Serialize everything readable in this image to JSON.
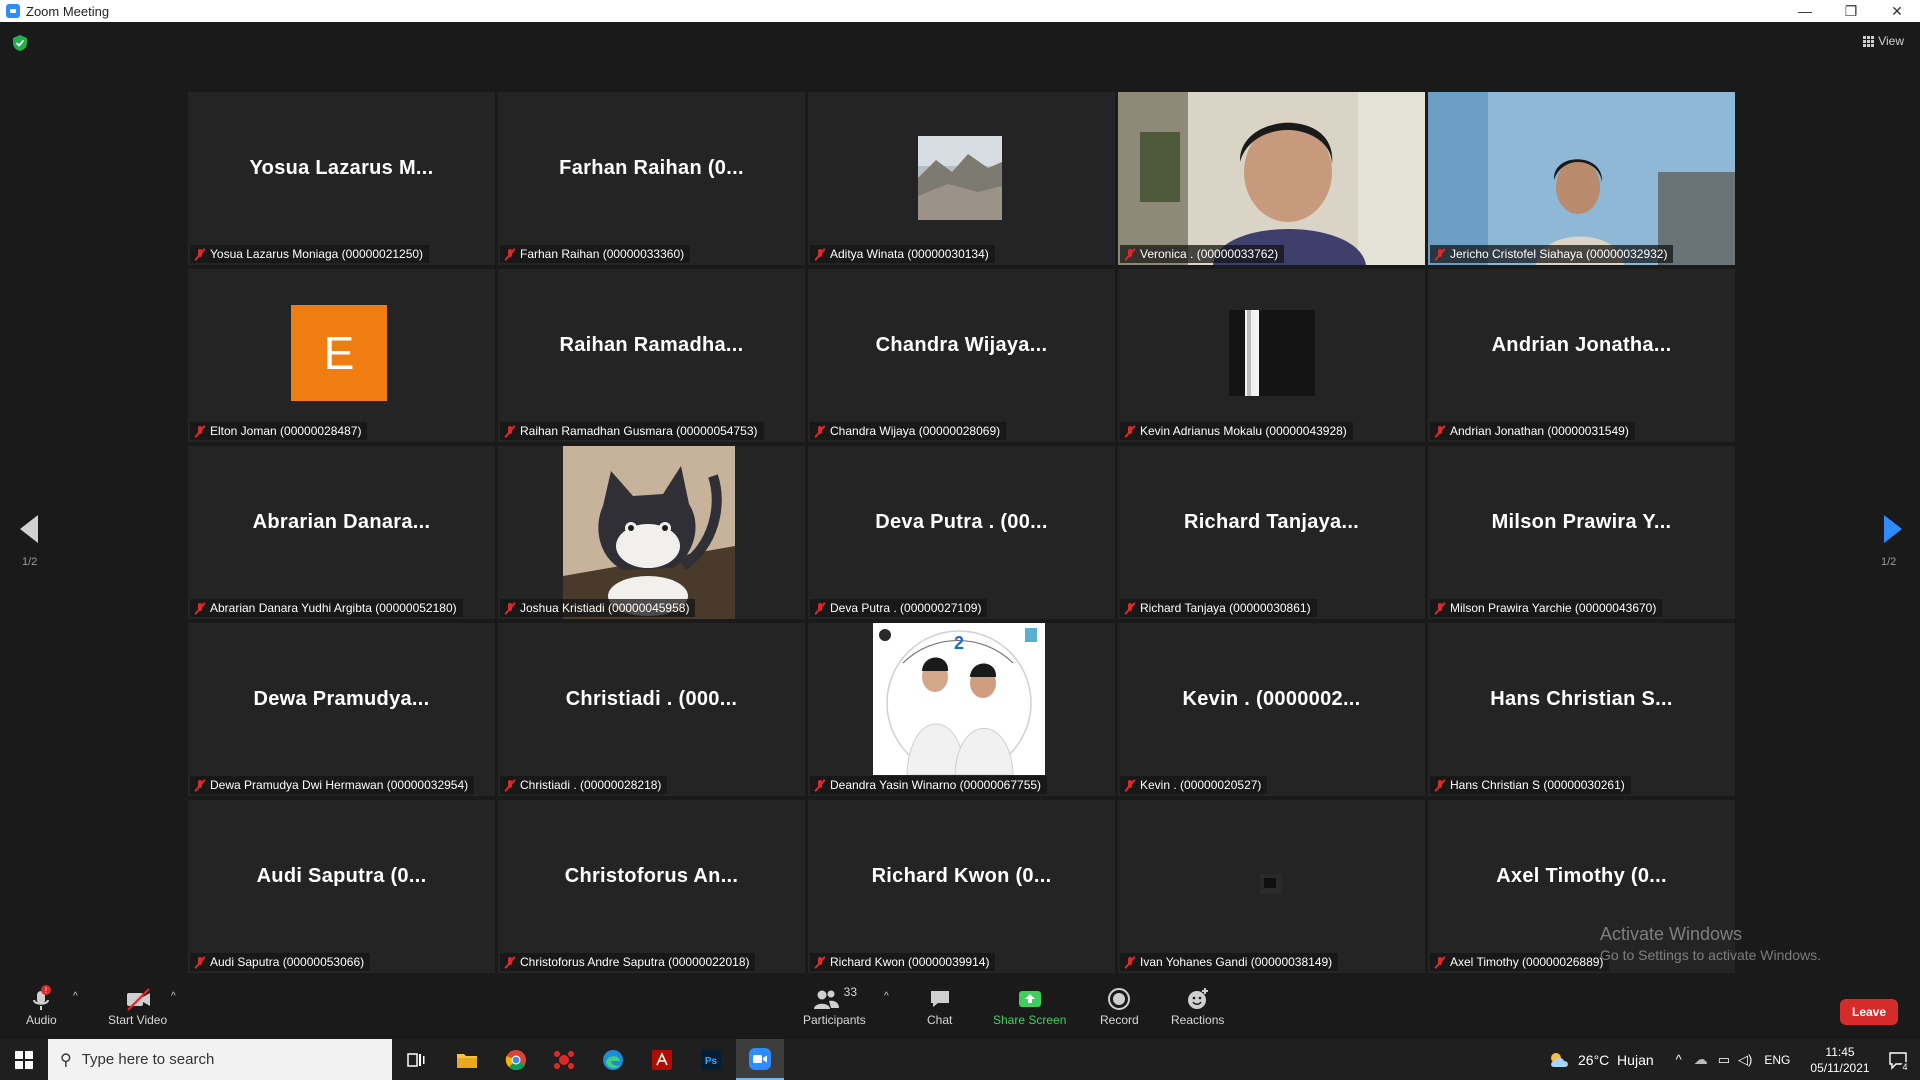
{
  "window": {
    "title": "Zoom Meeting",
    "controls": [
      "—",
      "❐",
      "✕"
    ]
  },
  "meeting": {
    "view_label": "View",
    "page_left": "1/2",
    "page_right": "1/2",
    "active_speaker_color": "#c8e650",
    "tiles": [
      {
        "display": "Yosua Lazarus M...",
        "label": "Yosua Lazarus Moniaga (00000021250)",
        "kind": "name"
      },
      {
        "display": "Farhan Raihan (0...",
        "label": "Farhan Raihan (00000033360)",
        "kind": "name"
      },
      {
        "display": "",
        "label": "Aditya Winata (00000030134)",
        "kind": "mountain"
      },
      {
        "display": "",
        "label": "Veronica . (00000033762)",
        "kind": "video-girl",
        "active": true
      },
      {
        "display": "",
        "label": "Jericho Cristofel Siahaya (00000032932)",
        "kind": "video-boy"
      },
      {
        "display": "E",
        "label": "Elton Joman (00000028487)",
        "kind": "avatar-letter"
      },
      {
        "display": "Raihan Ramadha...",
        "label": "Raihan Ramadhan Gusmara (00000054753)",
        "kind": "name"
      },
      {
        "display": "Chandra Wijaya...",
        "label": "Chandra Wijaya (00000028069)",
        "kind": "name"
      },
      {
        "display": "",
        "label": "Kevin Adrianus Mokalu (00000043928)",
        "kind": "dark-pic"
      },
      {
        "display": "Andrian Jonatha...",
        "label": "Andrian Jonathan (00000031549)",
        "kind": "name"
      },
      {
        "display": "Abrarian Danara...",
        "label": "Abrarian Danara Yudhi Argibta (00000052180)",
        "kind": "name"
      },
      {
        "display": "",
        "label": "Joshua Kristiadi (00000045958)",
        "kind": "cat"
      },
      {
        "display": "Deva Putra . (00...",
        "label": "Deva Putra . (00000027109)",
        "kind": "name"
      },
      {
        "display": "Richard Tanjaya...",
        "label": "Richard Tanjaya (00000030861)",
        "kind": "name"
      },
      {
        "display": "Milson Prawira Y...",
        "label": "Milson Prawira Yarchie (00000043670)",
        "kind": "name"
      },
      {
        "display": "Dewa Pramudya...",
        "label": "Dewa Pramudya Dwi Hermawan (00000032954)",
        "kind": "name"
      },
      {
        "display": "Christiadi . (000...",
        "label": "Christiadi . (00000028218)",
        "kind": "name"
      },
      {
        "display": "",
        "label": "Deandra Yasin Winarno (00000067755)",
        "kind": "photo"
      },
      {
        "display": "Kevin . (0000002...",
        "label": "Kevin . (00000020527)",
        "kind": "name"
      },
      {
        "display": "Hans Christian S...",
        "label": "Hans Christian S (00000030261)",
        "kind": "name"
      },
      {
        "display": "Audi Saputra (0...",
        "label": "Audi Saputra (00000053066)",
        "kind": "name"
      },
      {
        "display": "Christoforus An...",
        "label": "Christoforus Andre Saputra (00000022018)",
        "kind": "name"
      },
      {
        "display": "Richard Kwon (0...",
        "label": "Richard Kwon (00000039914)",
        "kind": "name"
      },
      {
        "display": "",
        "label": "Ivan Yohanes Gandi (00000038149)",
        "kind": "tiny-pic"
      },
      {
        "display": "Axel Timothy (0...",
        "label": "Axel Timothy (00000026889)",
        "kind": "name"
      }
    ]
  },
  "watermark": {
    "title": "Activate Windows",
    "subtitle": "Go to Settings to activate Windows."
  },
  "toolbar": {
    "audio": "Audio",
    "start_video": "Start Video",
    "participants": "Participants",
    "participants_count": "33",
    "chat": "Chat",
    "share_screen": "Share Screen",
    "record": "Record",
    "reactions": "Reactions",
    "leave": "Leave",
    "share_color": "#3fcf5e",
    "leave_color": "#d52b2b"
  },
  "taskbar": {
    "search_placeholder": "Type here to search",
    "weather": "26°C  Hujan",
    "language": "ENG",
    "time": "11:45",
    "date": "05/11/2021",
    "notifications": "4"
  }
}
